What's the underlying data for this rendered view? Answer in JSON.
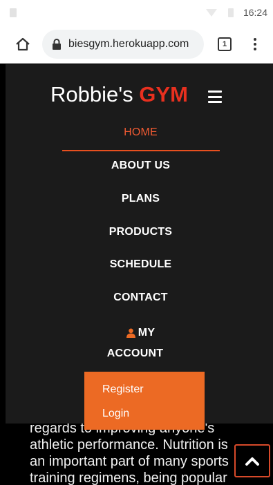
{
  "status_bar": {
    "time": "16:24"
  },
  "browser": {
    "url": "biesgym.herokuapp.com",
    "tab_count": "1"
  },
  "brand": {
    "name": "Robbie's ",
    "accent": "GYM"
  },
  "nav": {
    "items": [
      {
        "label": "HOME"
      },
      {
        "label": "ABOUT US"
      },
      {
        "label": "PLANS"
      },
      {
        "label": "PRODUCTS"
      },
      {
        "label": "SCHEDULE"
      },
      {
        "label": "CONTACT"
      }
    ],
    "account_line1": "MY",
    "account_line2": "ACCOUNT"
  },
  "dropdown": {
    "register": "Register",
    "login": "Login"
  },
  "body_text": {
    "line1": "regards to improving anyone's",
    "line2": "athletic performance. Nutrition is",
    "line3": "an important part of many sports",
    "line4": "training regimens, being popular"
  },
  "colors": {
    "accent": "#e8301f",
    "dropdown": "#ec6a24",
    "nav_bg": "#1b1b1b"
  }
}
